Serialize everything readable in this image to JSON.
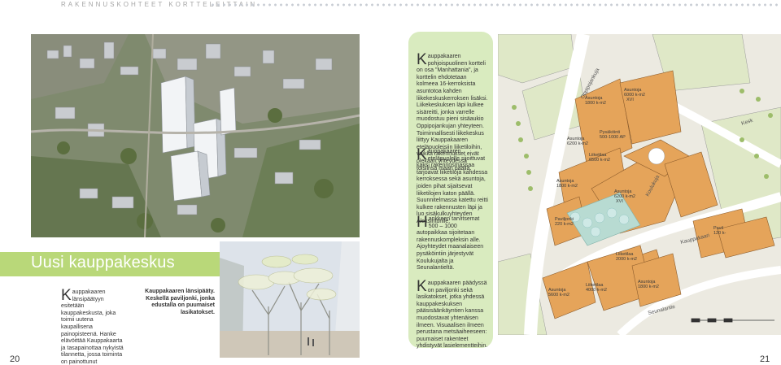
{
  "header": {
    "title": "RAKENNUSKOHTEET KORTTELEITTAIN"
  },
  "left": {
    "title": "Uusi kauppakeskus",
    "intro_cap": "K",
    "intro": "auppakaaren länsipäätyyn esitetään kauppakeskusta, joka toimii uutena kaupallisena painopisteenä. Hanke elävöittää Kauppakaarta ja tasapainottaa nykyistä tilannetta, jossa toiminta on painottunut Puuvalonaukion ympärille.",
    "caption": "Kauppakaaren länsipääty. Keskellä paviljonki, jonka edustalla on puumaiset lasikatokset.",
    "page_number": "20"
  },
  "panel": {
    "p1_cap": "K",
    "p1": "auppakaaren pohjoispuolinen kortteli on osa \"Manhattania\", ja korttelin ehdotetaan kolmeea 16-kerroksista asuntotoa kahden liikekeskuskerroksen lisäksi. Liikekeskuksen läpi kulkee sisäreitti, jonka varrelle muodostuu pieni sisäaukio Oppipojankujan yhteyteen. Toiminnallisesti liikekeskus liittyy Kauppakaaren eteläpuoleisiin liiketiloihin, vaikka rakennukset eivät olekaan yhteydessä toisiinsa maan päällä.",
    "p2_cap": "K",
    "p2": "auppakaaren eteläpuolelle sijoittuvat kaksi rakennusmassaa tarjoavat liiketiloja kahdessa kerroksessa sekä asuntoja, joiden pihat sijaitsevat liiketilojen katon päällä. Suunnitelmassa katettu reitti kulkee rakennusten läpi ja luo sisäkulkuyhteyden Aleksintorille.",
    "p3_cap": "H",
    "p3": "ankkeen tarvitsemat 500 – 1000 autopaikkaa sijoitetaan rakennuskompleksin alle. Ajoyhteydet maanalaiseen pysäköintiin järjestyvät Koulukujalta ja Seunalantieltä.",
    "p4_cap": "K",
    "p4": "auppakaaren päädyssä on paviljonki sekä lasikatokset, jotka yhdessä kauppakeskuksen pääsisäänkäyntien kanssa muodostavat yhtenäisen ilmeen. Visuaalisen ilmeen perustana metsäaiheeseen: puumaiset rakenteet yhdistyvät lasielementteihin."
  },
  "map": {
    "labels": [
      {
        "t": "Asuntoja\n6000 k-m2\nXVI",
        "k": "a1"
      },
      {
        "t": "Asuntoja\n1800 k-m2",
        "k": "a2"
      },
      {
        "t": "Asuntoja\n6200 k-m2",
        "k": "a3"
      },
      {
        "t": "Pysäköinti\n500-1000 AP",
        "k": "a4"
      },
      {
        "t": "Liiketilaa\n6500 k-m2",
        "k": "a5"
      },
      {
        "t": "Asuntoja\n1800 k-m2",
        "k": "a6"
      },
      {
        "t": "Asuntoja\n6200 k-m2\nXVI",
        "k": "a7"
      },
      {
        "t": "Paviljonki\n220 k-m2",
        "k": "a8"
      },
      {
        "t": "Liiketilaa\n2000 k-m2",
        "k": "a9"
      },
      {
        "t": "Liiketilaa\n4000 k-m2",
        "k": "a10"
      },
      {
        "t": "Asuntoja\n1800 k-m2",
        "k": "a11"
      },
      {
        "t": "Asuntoja\n5600 k-m2",
        "k": "a12"
      },
      {
        "t": "Pavil\n120 k-",
        "k": "a13"
      }
    ],
    "streets": [
      "Kauppakaari",
      "Oppipojankuja",
      "Kesk",
      "Seunalantie",
      "Koulukuja"
    ],
    "page_number": "21"
  }
}
